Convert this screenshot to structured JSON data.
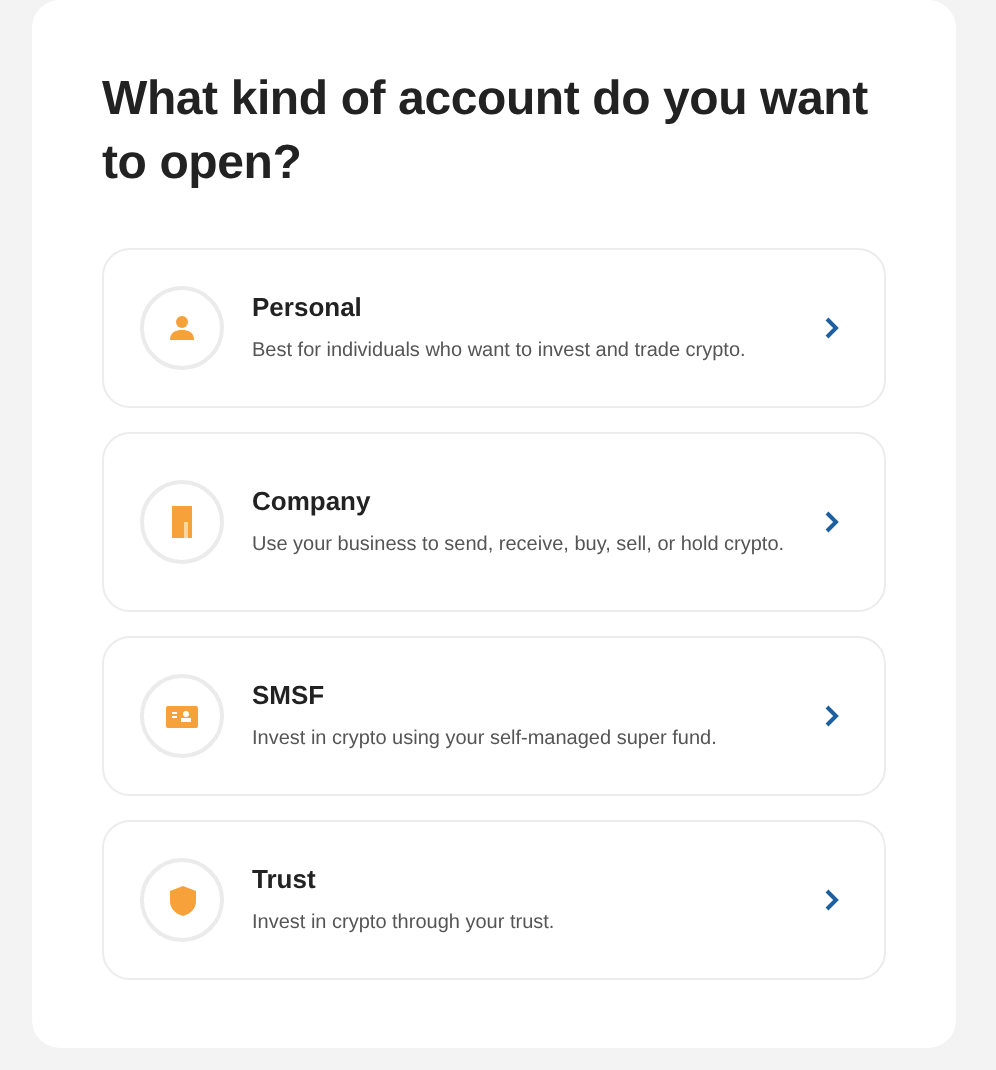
{
  "title": "What kind of account do you want to open?",
  "options": [
    {
      "kind": "person",
      "name": "Personal",
      "description": "Best for individuals who want to invest and trade crypto."
    },
    {
      "kind": "building",
      "name": "Company",
      "description": "Use your business to send, receive, buy, sell, or hold crypto."
    },
    {
      "kind": "card",
      "name": "SMSF",
      "description": "Invest in crypto using your self-managed super fund."
    },
    {
      "kind": "shield",
      "name": "Trust",
      "description": "Invest in crypto through your trust."
    }
  ]
}
